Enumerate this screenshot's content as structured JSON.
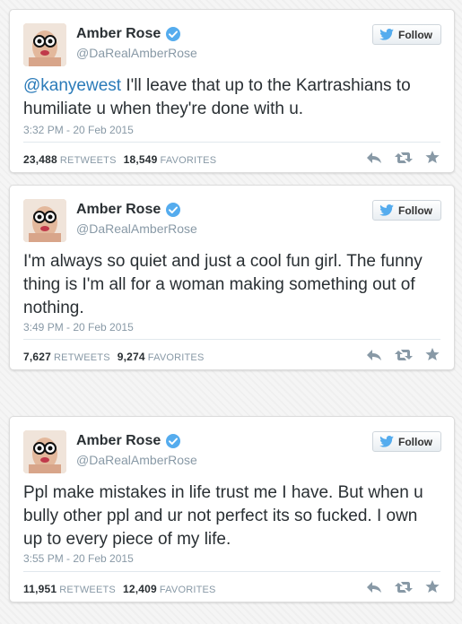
{
  "colors": {
    "link": "#2b7bb9",
    "verified": "#55acee",
    "muted": "#8899a6",
    "text": "#292f33",
    "follow_icon": "#55acee"
  },
  "tweets": [
    {
      "name": "Amber Rose",
      "handle": "@DaRealAmberRose",
      "follow_label": "Follow",
      "mention": "@kanyewest",
      "text": " I'll leave that up to the Kartrashians to humiliate u when they're done with u.",
      "timestamp": "3:32 PM - 20 Feb 2015",
      "retweets": "23,488",
      "retweets_label": "RETWEETS",
      "favorites": "18,549",
      "favorites_label": "FAVORITES"
    },
    {
      "name": "Amber Rose",
      "handle": "@DaRealAmberRose",
      "follow_label": "Follow",
      "text": "I'm always so quiet and just a cool fun girl. The funny thing is I'm all for a woman making something out of nothing.",
      "timestamp": "3:49 PM - 20 Feb 2015",
      "retweets": "7,627",
      "retweets_label": "RETWEETS",
      "favorites": "9,274",
      "favorites_label": "FAVORITES"
    },
    {
      "name": "Amber Rose",
      "handle": "@DaRealAmberRose",
      "follow_label": "Follow",
      "text": "Ppl make mistakes in life trust me I have. But when u bully other ppl and ur not perfect its so fucked. I own up to every piece of my life.",
      "timestamp": "3:55 PM - 20 Feb 2015",
      "retweets": "11,951",
      "retweets_label": "RETWEETS",
      "favorites": "12,409",
      "favorites_label": "FAVORITES"
    }
  ]
}
